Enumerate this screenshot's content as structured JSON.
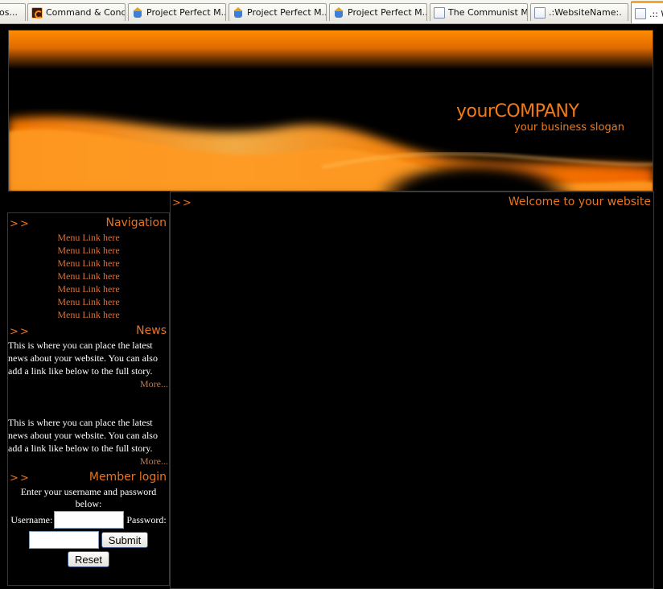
{
  "browser": {
    "tabs": [
      {
        "label": "os...",
        "icon": "page-icon"
      },
      {
        "label": "Command & Conq...",
        "icon": "cnc-icon"
      },
      {
        "label": "Project Perfect M...",
        "icon": "ppm-icon"
      },
      {
        "label": "Project Perfect M...",
        "icon": "ppm-icon"
      },
      {
        "label": "Project Perfect M...",
        "icon": "ppm-icon"
      },
      {
        "label": "The Communist M...",
        "icon": "page-icon"
      },
      {
        "label": ".:WebsiteName:.",
        "icon": "page-icon"
      },
      {
        "label": ".:: W",
        "icon": "page-icon"
      }
    ]
  },
  "header": {
    "company": "yourCOMPANY",
    "slogan": "your business slogan"
  },
  "colors": {
    "accent": "#e8731f",
    "background": "#000000",
    "link": "#d8713c"
  },
  "main": {
    "arrows": ">>",
    "title": "Welcome to your website"
  },
  "navigation": {
    "arrows": ">>",
    "title": "Navigation",
    "links": [
      "Menu Link here",
      "Menu Link here",
      "Menu Link here",
      "Menu Link here",
      "Menu Link here",
      "Menu Link here",
      "Menu Link here"
    ]
  },
  "news": {
    "arrows": ">>",
    "title": "News",
    "items": [
      {
        "text": "This is where you can place the latest news about your website. You can also add a link like below to the full story.",
        "more": "More..."
      },
      {
        "text": "This is where you can place the latest news about your website. You can also add a link like below to the full story.",
        "more": "More..."
      }
    ]
  },
  "login": {
    "arrows": ">>",
    "title": "Member login",
    "intro": "Enter your username and password below:",
    "username_label": "Username:",
    "password_label": "Password:",
    "username_value": "",
    "password_value": "",
    "submit_label": "Submit",
    "reset_label": "Reset"
  }
}
